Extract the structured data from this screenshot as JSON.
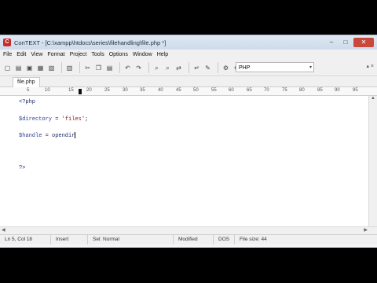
{
  "window": {
    "title": "ConTEXT - [C:\\xampp\\htdocs\\series\\filehandling\\file.php *]",
    "app_icon_letter": "C",
    "min_label": "–",
    "max_label": "□",
    "close_label": "✕"
  },
  "menu": [
    "File",
    "Edit",
    "View",
    "Format",
    "Project",
    "Tools",
    "Options",
    "Window",
    "Help"
  ],
  "toolbar": {
    "language": "PHP",
    "dropdown_arrow": "▾",
    "right_label": "▴ ×"
  },
  "tab": {
    "label": "file.php"
  },
  "ruler": {
    "ticks": [
      "5",
      "10",
      "15",
      "20",
      "25",
      "30",
      "35",
      "40",
      "45",
      "50",
      "55",
      "60",
      "65",
      "70",
      "75",
      "80",
      "85",
      "90",
      "95"
    ]
  },
  "editor": {
    "line1": "<?php",
    "line2_var": "$directory",
    "line2_rest": " = ",
    "line2_str": "'files'",
    "line2_end": ";",
    "line3_var": "$handle",
    "line3_rest": " = opendir",
    "line4": "?>"
  },
  "status": {
    "position": "Ln 5, Col 18",
    "insert": "Insert",
    "sel": "Sel: Normal",
    "modified": "Modified",
    "encoding": "DOS",
    "filesize": "File size: 44"
  }
}
